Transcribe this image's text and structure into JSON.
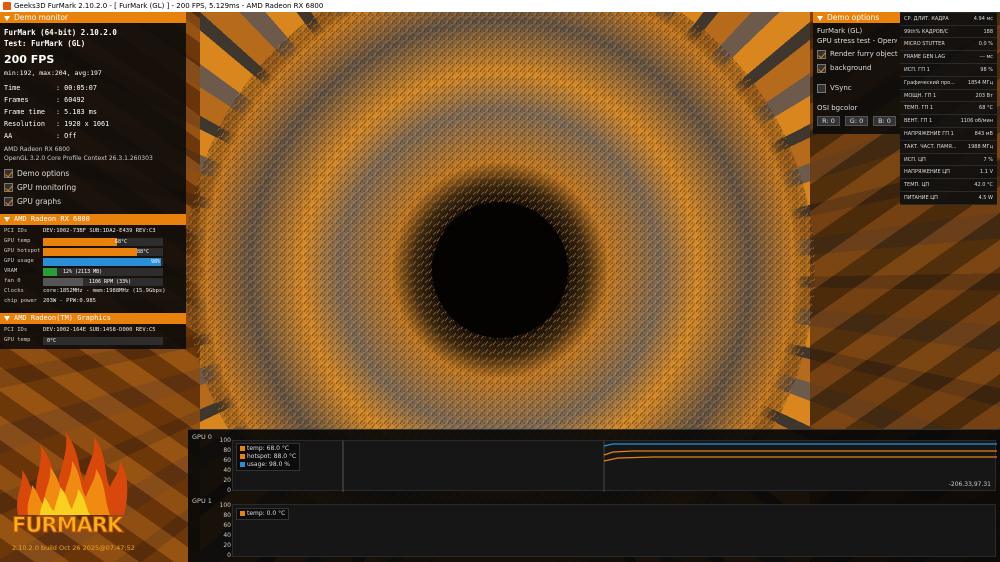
{
  "window": {
    "title": "Geeks3D FurMark 2.10.2.0 - [ FurMark (GL) ] - 200 FPS, 5.129ms - AMD Radeon RX 6800"
  },
  "demo_monitor": {
    "header": "Demo monitor",
    "app_name": "FurMark (64-bit) 2.10.2.0",
    "test": "Test: FurMark (GL)",
    "fps": "200 FPS",
    "fps_stats": "min:192, max:204, avg:197",
    "rows": [
      {
        "label": "Time",
        "value": ": 00:05:07"
      },
      {
        "label": "Frames",
        "value": ": 60492"
      },
      {
        "label": "Frame time",
        "value": ": 5.183 ms"
      },
      {
        "label": "Resolution",
        "value": ": 1920 x 1061"
      },
      {
        "label": "AA",
        "value": ": Off"
      }
    ],
    "gpu_name": "AMD Radeon RX 6800",
    "gl_info": "OpenGL 3.2.0 Core Profile Context 26.3.1.260303",
    "options": [
      {
        "label": "Demo options",
        "checked": true
      },
      {
        "label": "GPU monitoring",
        "checked": true
      },
      {
        "label": "GPU graphs",
        "checked": true
      }
    ]
  },
  "gpu_monitor": {
    "header": "AMD Radeon RX 6800",
    "pci_label": "PCI IDs",
    "pci_value": "DEV:1002-73BF SUB:1DA2-E439 REV:C3",
    "temp_label": "GPU temp",
    "temp_value": "68°C",
    "temp_level": 0.62,
    "hotspot_label": "GPU hotspot",
    "hotspot_value": "88°C",
    "hotspot_level": 0.78,
    "usage_label": "GPU usage",
    "usage_value": "98%",
    "usage_level": 0.98,
    "vram_label": "VRAM",
    "vram_value": "12% (2113 MB)",
    "vram_level": 0.12,
    "fan_label": "fan 0",
    "fan_value": "1106 RPM (33%)",
    "fan_level": 0.33,
    "clocks_label": "Clocks",
    "clocks_value": "core:1852MHz - mem:1988MHz (15.9Gbps)",
    "power_label": "chip power",
    "power_value": "203W - PPW:0.985"
  },
  "gpu2_monitor": {
    "header": "AMD Radeon(TM) Graphics",
    "pci_label": "PCI IDs",
    "pci_value": "DEV:1002-164E SUB:1458-D000 REV:C5",
    "temp_label": "GPU temp",
    "temp_value": "0°C"
  },
  "demo_options": {
    "header": "Demo options",
    "name": "FurMark (GL)",
    "desc": "GPU stress test - OpenGL",
    "render_furry": "Render furry object",
    "background": "background",
    "vsync": "VSync",
    "osi_bgcolor": "OSI bgcolor",
    "r": "R: 0",
    "g": "G: 0",
    "b": "B: 0"
  },
  "overlay_stats": [
    {
      "k": "Кадр./с",
      "v": "203"
    },
    {
      "k": "СР. ДЛИТ. КАДРА",
      "v": "4.94 мс"
    },
    {
      "k": "99th% КАДРОВ/С",
      "v": "188"
    },
    {
      "k": "MICRO STUTTER",
      "v": "0.0 %"
    },
    {
      "k": "FRAME GEN LAG",
      "v": "--- мс"
    },
    {
      "k": "ИСП. ГП 1",
      "v": "98 %"
    },
    {
      "k": "Графический про...",
      "v": "1854 МГц"
    },
    {
      "k": "МОЩН. ГП 1",
      "v": "203 Вт"
    },
    {
      "k": "ТЕМП. ГП 1",
      "v": "68 °C"
    },
    {
      "k": "ВЕНТ. ГП 1",
      "v": "1106 об/мин"
    },
    {
      "k": "НАПРЯЖЕНИЕ ГП 1",
      "v": "843 мВ"
    },
    {
      "k": "ТАКТ. ЧАСТ. ПАМЯ...",
      "v": "1988 МГц"
    },
    {
      "k": "ИСП. ЦП",
      "v": "7 %"
    },
    {
      "k": "НАПРЯЖЕНИЕ ЦП",
      "v": "1.1 V"
    },
    {
      "k": "ТЕМП. ЦП",
      "v": "42.0 °C"
    },
    {
      "k": "ПИТАНИЕ ЦП",
      "v": "4.5 W"
    }
  ],
  "graphs": {
    "gpu0_label": "GPU 0",
    "gpu1_label": "GPU 1",
    "ticks": [
      "100",
      "80",
      "60",
      "40",
      "20",
      "0"
    ],
    "ticks1": [
      "100",
      "80",
      "60",
      "40",
      "20",
      "0"
    ],
    "legend0": [
      {
        "label": "temp: 68.0 °C",
        "color": "#e8820c"
      },
      {
        "label": "hotspot: 88.0 °C",
        "color": "#e8820c"
      },
      {
        "label": "usage: 98.0 %",
        "color": "#2a8fd6"
      }
    ],
    "legend1": [
      {
        "label": "temp: 0.0 °C",
        "color": "#e8820c"
      }
    ],
    "coords": "-206.33,97.31"
  },
  "logo": {
    "word": "FURMARK",
    "build": "2.10.2.0 build Oct 26 2025@07:47:52"
  },
  "colors": {
    "accent": "#e8820c",
    "usage_bar": "#2a8fd6",
    "vram_bar": "#2e9b3a"
  }
}
